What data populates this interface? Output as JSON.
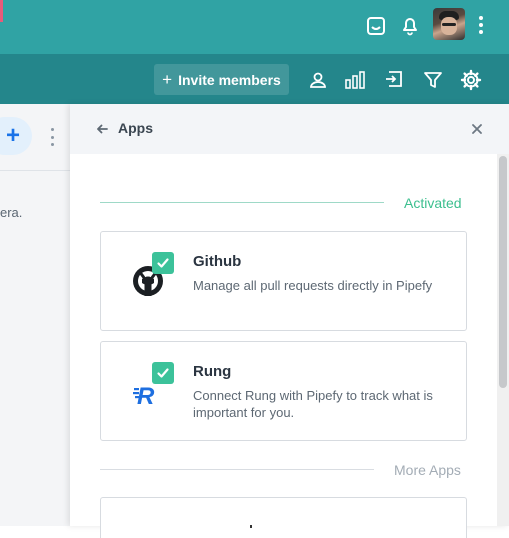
{
  "topbar": {
    "icons": [
      "inbox-icon",
      "bell-icon"
    ],
    "avatar_icon": "user-avatar",
    "more_icon": "kebab-menu-icon"
  },
  "toolbar": {
    "invite_label": "Invite members",
    "icons": [
      "person-icon",
      "bar-chart-icon",
      "import-icon",
      "filter-icon",
      "gear-icon"
    ]
  },
  "left_panel": {
    "text_fragment": "era.",
    "add_label": "+"
  },
  "apps_panel": {
    "title": "Apps",
    "activated_label": "Activated",
    "more_apps_label": "More Apps",
    "apps": [
      {
        "name": "Github",
        "description": "Manage all pull requests directly in Pipefy",
        "icon": "github-icon",
        "activated": true
      },
      {
        "name": "Rung",
        "description": "Connect Rung with Pipefy to track what is important for you.",
        "icon": "rung-icon",
        "activated": true
      }
    ]
  },
  "colors": {
    "topbar": "#30a3a4",
    "toolbar": "#24868b",
    "accent_green": "#3cc29a",
    "rung_blue": "#1e6fe0"
  }
}
